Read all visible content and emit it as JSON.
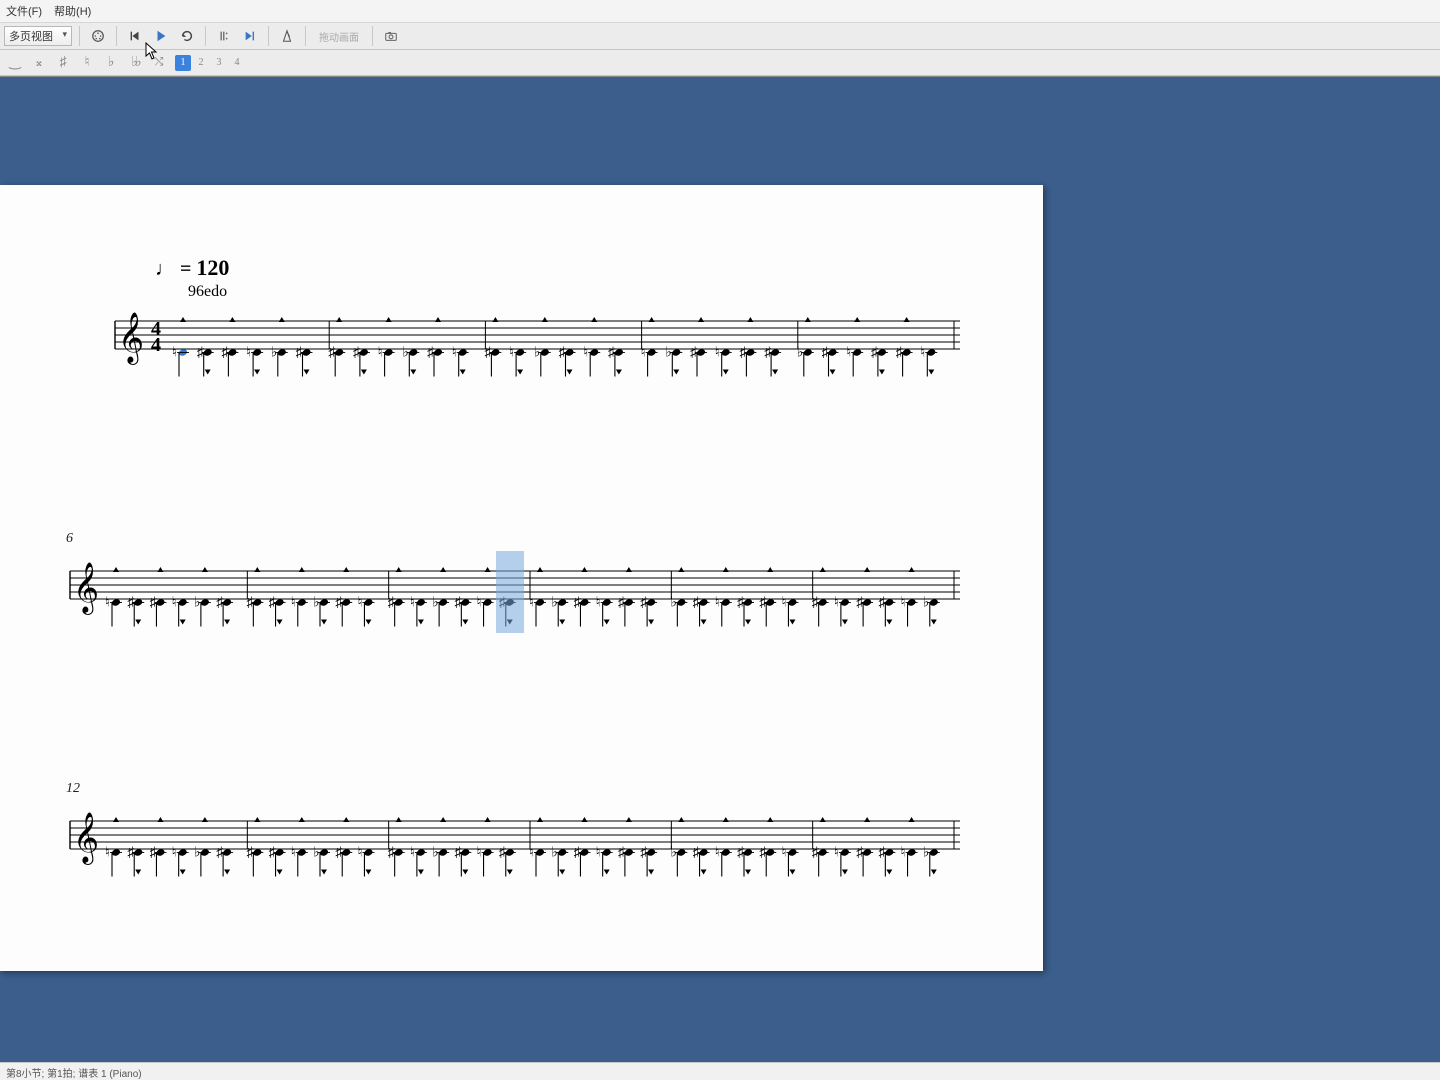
{
  "menu": {
    "items": [
      "文件(F)",
      "帮助(H)"
    ]
  },
  "toolbar": {
    "workspace": "多页视图",
    "pan_label": "拖动画面"
  },
  "voices": {
    "labels": [
      "1",
      "2",
      "3",
      "4"
    ],
    "active": 0
  },
  "score": {
    "tempo_prefix": "♩ = ",
    "tempo_value": "120",
    "subtitle": "96edo",
    "systems": [
      {
        "label": "",
        "measures": 5,
        "notes_per_measure": 6,
        "first_note_blue": true,
        "show_timesig": true
      },
      {
        "label": "6",
        "measures": 6,
        "notes_per_measure": 6,
        "first_note_blue": false,
        "show_timesig": false
      },
      {
        "label": "12",
        "measures": 6,
        "notes_per_measure": 6,
        "first_note_blue": false,
        "show_timesig": false
      }
    ],
    "selection": {
      "system": 1,
      "measure": 2,
      "note": 5
    }
  },
  "status": "第8小节; 第1拍; 谱表 1 (Piano)"
}
